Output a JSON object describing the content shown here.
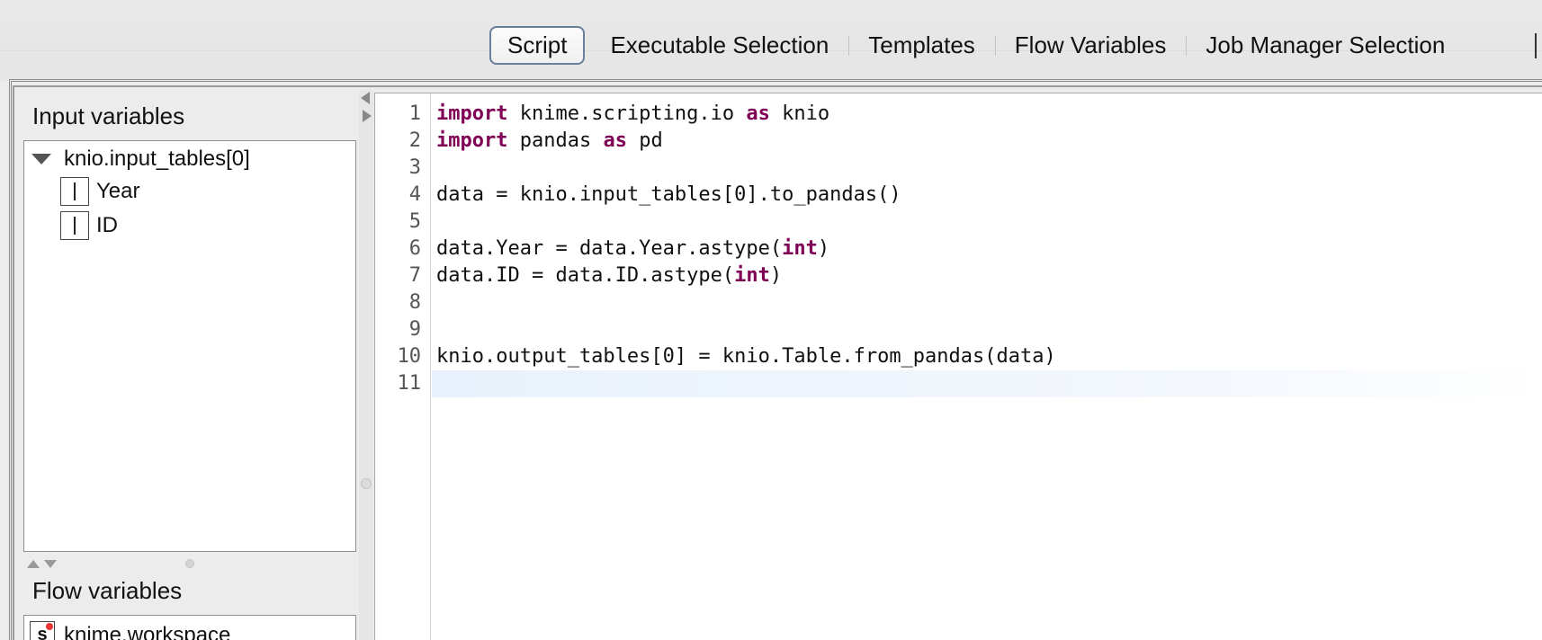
{
  "tabs": [
    {
      "label": "Script",
      "active": true
    },
    {
      "label": "Executable Selection",
      "active": false
    },
    {
      "label": "Templates",
      "active": false
    },
    {
      "label": "Flow Variables",
      "active": false
    },
    {
      "label": "Job Manager Selection",
      "active": false
    }
  ],
  "left_panel": {
    "input_title": "Input variables",
    "input_tree": {
      "root": "knio.input_tables[0]",
      "columns": [
        "Year",
        "ID"
      ]
    },
    "flow_title": "Flow variables",
    "flow_items": [
      "knime.workspace"
    ]
  },
  "editor": {
    "line_numbers": [
      "1",
      "2",
      "3",
      "4",
      "5",
      "6",
      "7",
      "8",
      "9",
      "10",
      "11"
    ],
    "lines": [
      [
        {
          "t": "import",
          "k": true
        },
        {
          "t": " knime.scripting.io "
        },
        {
          "t": "as",
          "k": true
        },
        {
          "t": " knio"
        }
      ],
      [
        {
          "t": "import",
          "k": true
        },
        {
          "t": " pandas "
        },
        {
          "t": "as",
          "k": true
        },
        {
          "t": " pd"
        }
      ],
      [],
      [
        {
          "t": "data = knio.input_tables[0].to_pandas()"
        }
      ],
      [],
      [
        {
          "t": "data.Year = data.Year.astype("
        },
        {
          "t": "int",
          "k": true
        },
        {
          "t": ")"
        }
      ],
      [
        {
          "t": "data.ID = data.ID.astype("
        },
        {
          "t": "int",
          "k": true
        },
        {
          "t": ")"
        }
      ],
      [],
      [],
      [
        {
          "t": "knio.output_tables[0] = knio.Table.from_pandas(data)"
        }
      ],
      []
    ],
    "keyword_color": "#7f0055"
  }
}
